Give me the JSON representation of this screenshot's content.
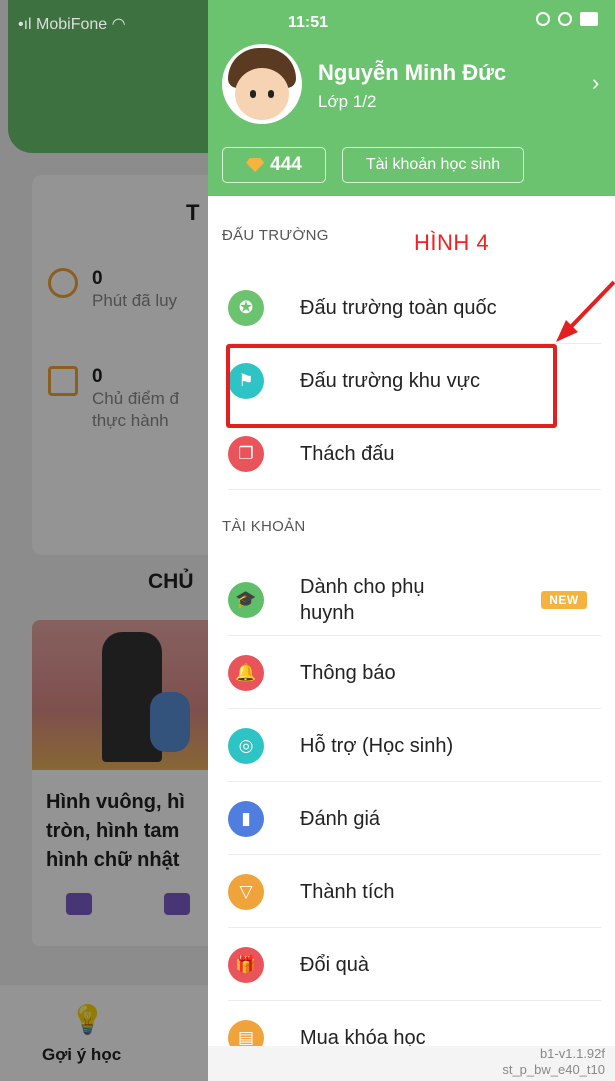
{
  "status_bar": {
    "carrier": "MobiFone",
    "time": "11:51"
  },
  "background": {
    "card_title": "T",
    "stats": [
      {
        "value": "0",
        "label": "Phút đã luy"
      },
      {
        "value": "0",
        "label": "Chủ điểm đ",
        "label2": "thực hành"
      }
    ],
    "topic_title": "CHỦ",
    "lesson": {
      "line1": "Hình vuông, hì",
      "line2": "tròn, hình tam",
      "line3": "hình chữ nhật"
    },
    "bottom_tab": "Gợi ý học"
  },
  "drawer": {
    "user": {
      "name": "Nguyễn Minh Đức",
      "class": "Lớp 1/2"
    },
    "gems": "444",
    "account_type": "Tài khoản học sinh",
    "annotation": "HÌNH 4",
    "sections": {
      "arena": "ĐẤU TRƯỜNG",
      "account": "TÀI KHOẢN"
    },
    "arena_items": [
      {
        "label": "Đấu trường toàn quốc",
        "icon": "medal-icon",
        "color": "#6cc36f"
      },
      {
        "label": "Đấu trường khu vực",
        "icon": "region-icon",
        "color": "#2ec4c6"
      },
      {
        "label": "Thách đấu",
        "icon": "challenge-icon",
        "color": "#e9545a"
      }
    ],
    "account_items": [
      {
        "label": "Dành cho phụ",
        "label2": "huynh",
        "badge": "NEW",
        "icon": "graduation-cap-icon",
        "color": "#5fbe6a"
      },
      {
        "label": "Thông báo",
        "icon": "bell-icon",
        "color": "#e9545a"
      },
      {
        "label": "Hỗ trợ (Học sinh)",
        "icon": "lifebuoy-icon",
        "color": "#2ec4c6"
      },
      {
        "label": "Đánh giá",
        "icon": "bar-chart-icon",
        "color": "#4f7de0"
      },
      {
        "label": "Thành tích",
        "icon": "trophy-icon",
        "color": "#f0a33a"
      },
      {
        "label": "Đổi quà",
        "icon": "gift-icon",
        "color": "#e9545a"
      },
      {
        "label": "Mua khóa học",
        "icon": "cart-icon",
        "color": "#f0a33a"
      }
    ],
    "version_line1": "b1-v1.1.92f",
    "version_line2": "st_p_bw_e40_t10"
  }
}
